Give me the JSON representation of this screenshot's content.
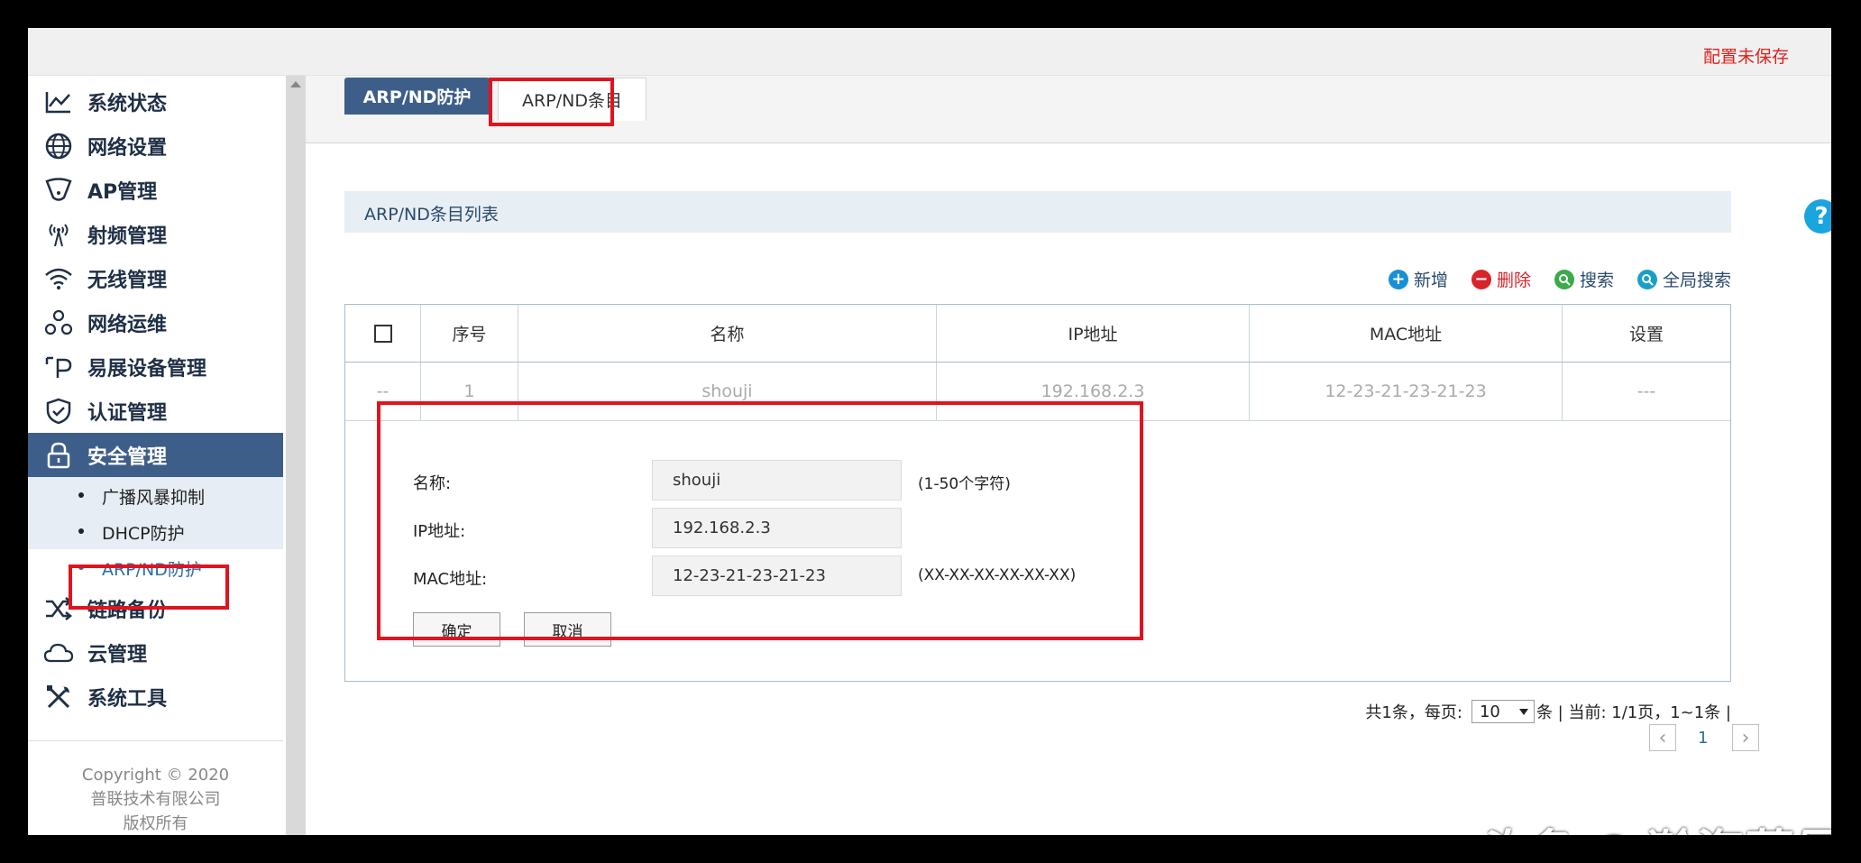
{
  "topbar": {
    "status_text": "配置未保存"
  },
  "sidebar": {
    "items": [
      {
        "label": "系统状态",
        "icon": "chart-line-icon"
      },
      {
        "label": "网络设置",
        "icon": "globe-icon"
      },
      {
        "label": "AP管理",
        "icon": "ap-shield-icon"
      },
      {
        "label": "射频管理",
        "icon": "antenna-icon"
      },
      {
        "label": "无线管理",
        "icon": "wifi-icon"
      },
      {
        "label": "网络运维",
        "icon": "network-ops-icon"
      },
      {
        "label": "易展设备管理",
        "icon": "device-p-icon"
      },
      {
        "label": "认证管理",
        "icon": "check-shield-icon"
      },
      {
        "label": "安全管理",
        "icon": "lock-icon",
        "active": true
      },
      {
        "label": "链路备份",
        "icon": "shuffle-icon"
      },
      {
        "label": "云管理",
        "icon": "cloud-icon"
      },
      {
        "label": "系统工具",
        "icon": "tools-icon"
      }
    ],
    "subitems": [
      {
        "label": "广播风暴抑制"
      },
      {
        "label": "DHCP防护"
      },
      {
        "label": "ARP/ND防护",
        "selected": true
      }
    ],
    "copyright": [
      "Copyright © 2020",
      "普联技术有限公司",
      "版权所有"
    ]
  },
  "tabs": [
    {
      "label": "ARP/ND防护"
    },
    {
      "label": "ARP/ND条目"
    }
  ],
  "section": {
    "title": "ARP/ND条目列表"
  },
  "actions": {
    "add": "新增",
    "delete": "删除",
    "search": "搜索",
    "global_search": "全局搜索"
  },
  "table": {
    "headers": [
      "序号",
      "名称",
      "IP地址",
      "MAC地址",
      "设置"
    ],
    "rows": [
      {
        "check": "--",
        "index": "1",
        "name": "shouji",
        "ip": "192.168.2.3",
        "mac": "12-23-21-23-21-23",
        "settings": "---"
      }
    ]
  },
  "form": {
    "name_label": "名称:",
    "name_value": "shouji",
    "name_hint": "(1-50个字符)",
    "ip_label": "IP地址:",
    "ip_value": "192.168.2.3",
    "mac_label": "MAC地址:",
    "mac_value": "12-23-21-23-21-23",
    "mac_hint": "(XX-XX-XX-XX-XX-XX)",
    "ok_label": "确定",
    "cancel_label": "取消"
  },
  "pager": {
    "total_text": "共1条，每页:",
    "per_page": "10",
    "suffix_text": "条 | 当前: 1/1页，1~1条 |",
    "page": "1",
    "prev": "‹",
    "next": "›"
  },
  "help": {
    "label": "?"
  },
  "watermark": "头条 @瀚海蓝昊王",
  "colors": {
    "accent": "#3e5e8a",
    "highlight": "#e0141e",
    "add": "#1a8fd6",
    "delete": "#d9232a",
    "search": "#3aaa4a",
    "global_search": "#1aa0c8"
  }
}
